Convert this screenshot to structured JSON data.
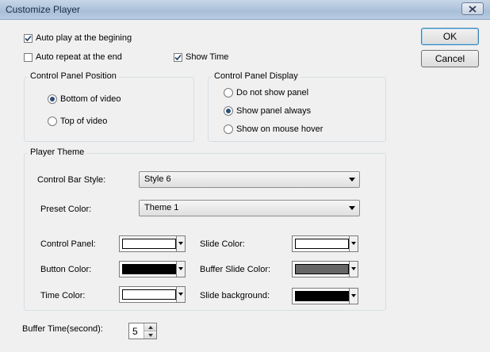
{
  "window": {
    "title": "Customize Player"
  },
  "buttons": {
    "ok": "OK",
    "cancel": "Cancel"
  },
  "options": {
    "auto_play": {
      "label": "Auto play at the begining",
      "checked": true
    },
    "auto_repeat": {
      "label": "Auto repeat at the end",
      "checked": false
    },
    "show_time": {
      "label": "Show Time",
      "checked": true
    }
  },
  "position_group": {
    "title": "Control Panel Position",
    "items": [
      {
        "label": "Bottom of video",
        "selected": true
      },
      {
        "label": "Top of video",
        "selected": false
      }
    ]
  },
  "display_group": {
    "title": "Control Panel Display",
    "items": [
      {
        "label": "Do not show panel",
        "selected": false
      },
      {
        "label": "Show panel always",
        "selected": true
      },
      {
        "label": "Show on mouse hover",
        "selected": false
      }
    ]
  },
  "theme": {
    "title": "Player Theme",
    "style_label": "Control Bar Style:",
    "style_value": "Style 6",
    "preset_label": "Preset Color:",
    "preset_value": "Theme 1",
    "colors": [
      {
        "label": "Control Panel:",
        "color": "#ffffff"
      },
      {
        "label": "Button Color:",
        "color": "#000000"
      },
      {
        "label": "Time Color:",
        "color": "#ffffff"
      },
      {
        "label": "Slide Color:",
        "color": "#ffffff"
      },
      {
        "label": "Buffer Slide Color:",
        "color": "#666666"
      },
      {
        "label": "Slide background:",
        "color": "#000000"
      }
    ]
  },
  "buffer": {
    "label": "Buffer Time(second):",
    "value": "5"
  }
}
